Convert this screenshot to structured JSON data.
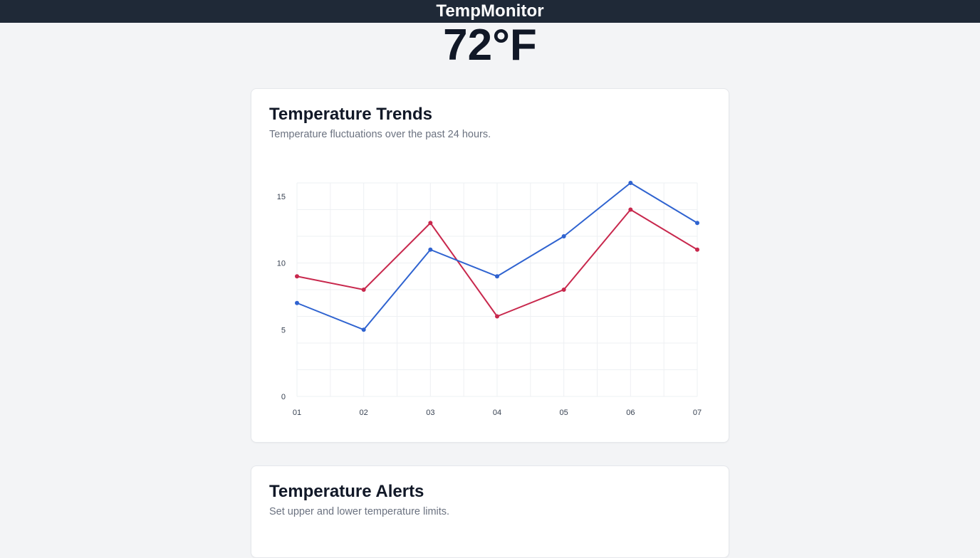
{
  "header": {
    "app_title": "TempMonitor"
  },
  "current": {
    "temperature": "72°F"
  },
  "trends": {
    "title": "Temperature Trends",
    "subtitle": "Temperature fluctuations over the past 24 hours."
  },
  "alerts": {
    "title": "Temperature Alerts",
    "subtitle": "Set upper and lower temperature limits."
  },
  "colors": {
    "series_blue": "#2f63d0",
    "series_red": "#c8284d"
  },
  "chart_data": {
    "type": "line",
    "title": "",
    "xlabel": "",
    "ylabel": "",
    "categories": [
      "01",
      "02",
      "03",
      "04",
      "05",
      "06",
      "07"
    ],
    "series": [
      {
        "color": "#2f63d0",
        "values": [
          7,
          5,
          11,
          9,
          12,
          16,
          13
        ]
      },
      {
        "color": "#c8284d",
        "values": [
          9,
          8,
          13,
          6,
          8,
          14,
          11
        ]
      }
    ],
    "ylim": [
      0,
      16
    ],
    "yticks": [
      0,
      5,
      10,
      15
    ],
    "grid": true,
    "legend": "none"
  }
}
